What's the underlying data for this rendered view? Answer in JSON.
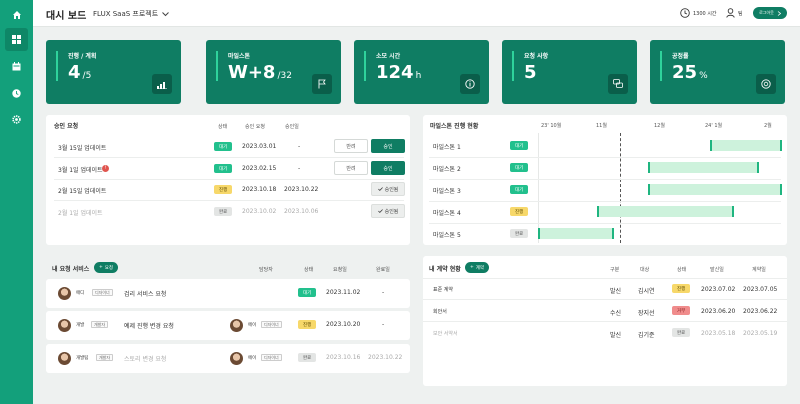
{
  "header": {
    "title": "대시 보드",
    "project": "FLUX SaaS 프로젝트",
    "time_label": "1300 시간",
    "user_label": "팀",
    "logout_label": "로그아웃"
  },
  "sidebar": {
    "items": [
      {
        "icon": "home-icon"
      },
      {
        "icon": "dashboard-grid-icon"
      },
      {
        "icon": "calendar-icon"
      },
      {
        "icon": "clock-icon"
      },
      {
        "icon": "settings-icon"
      }
    ]
  },
  "kpis": [
    {
      "label": "진행 / 계획",
      "value": "4",
      "sub": "/5",
      "icon": "bar-chart-icon"
    },
    {
      "label": "마일스톤",
      "value": "W+8",
      "sub": "/32",
      "icon": "flag-icon"
    },
    {
      "label": "소모 시간",
      "value": "124",
      "sub": "h",
      "icon": "info-icon"
    },
    {
      "label": "요청 사항",
      "value": "5",
      "sub": "",
      "icon": "chat-icon"
    },
    {
      "label": "공정률",
      "value": "25",
      "sub": "%",
      "icon": "gauge-icon"
    }
  ],
  "approvals": {
    "title": "승인 요청",
    "headers": [
      "상태",
      "승인 요청",
      "승인일"
    ],
    "rows": [
      {
        "name": "3월 15일 업데이트",
        "status": "대기",
        "requested": "2023.03.01",
        "approved": "-",
        "btn1": "반려",
        "btn2": "승인"
      },
      {
        "name": "3월 1일 업데이트",
        "status": "대기",
        "requested": "2023.02.15",
        "approved": "-",
        "btn1": "반려",
        "btn2": "승인"
      },
      {
        "name": "2월 15일 업데이트",
        "status": "진행",
        "requested": "2023.10.18",
        "approved": "2023.10.22",
        "btn1": "",
        "btn2": "승인됨"
      },
      {
        "name": "2월 1일 업데이트",
        "status": "완료",
        "requested": "2023.10.02",
        "approved": "2023.10.06",
        "btn1": "",
        "btn2": "승인됨"
      }
    ]
  },
  "milestones": {
    "title": "마일스톤 진행 현황",
    "months": [
      "23' 10월",
      "11월",
      "12월",
      "24' 1월",
      "2월"
    ],
    "rows": [
      {
        "name": "마일스톤 1",
        "status": "대기",
        "start": 0.7,
        "end": 0.995
      },
      {
        "name": "마일스톤 2",
        "status": "대기",
        "start": 0.45,
        "end": 0.9
      },
      {
        "name": "마일스톤 3",
        "status": "대기",
        "start": 0.45,
        "end": 0.995
      },
      {
        "name": "마일스톤 4",
        "status": "진행",
        "start": 0.24,
        "end": 0.8
      },
      {
        "name": "마일스톤 5",
        "status": "완료",
        "start": 0.0,
        "end": 0.31
      }
    ]
  },
  "my_requests": {
    "title": "내 요청 서비스",
    "add_label": "요청",
    "headers": [
      "담당자",
      "상태",
      "요청일",
      "완료일"
    ],
    "rows": [
      {
        "requester": "애디",
        "req_tag": "디자이너",
        "title": "검리 서비스 요청",
        "assignee": "",
        "asg_tag": "",
        "status": "대기",
        "requested": "2023.11.02",
        "done": "-"
      },
      {
        "requester": "개발",
        "req_tag": "개발자",
        "title": "예제 진행 변경 요청",
        "assignee": "에이",
        "asg_tag": "디자이너",
        "status": "진행",
        "requested": "2023.10.20",
        "done": "-"
      },
      {
        "requester": "개발팀",
        "req_tag": "개발자",
        "title": "스토리 변경 요청",
        "assignee": "에이",
        "asg_tag": "디자이너",
        "status": "완료",
        "requested": "2023.10.16",
        "done": "2023.10.22"
      }
    ]
  },
  "contracts": {
    "title": "내 계약 현황",
    "add_label": "계약",
    "headers": [
      "구분",
      "대상",
      "상태",
      "발신일",
      "계약일"
    ],
    "rows": [
      {
        "name": "표준 계약",
        "type": "발신",
        "target": "김시연",
        "status": "진행",
        "sent": "2023.07.02",
        "contract": "2023.07.05"
      },
      {
        "name": "회안서",
        "type": "수신",
        "target": "장지선",
        "status": "거부",
        "sent": "2023.06.20",
        "contract": "2023.06.22"
      },
      {
        "name": "보안 서약서",
        "type": "발신",
        "target": "김기준",
        "status": "완료",
        "sent": "2023.05.18",
        "contract": "2023.05.19"
      }
    ]
  },
  "colors": {
    "primary": "#13a07b",
    "dark": "#0f7d63",
    "accent": "#2fd29c",
    "bar": "#cdf2dc"
  }
}
